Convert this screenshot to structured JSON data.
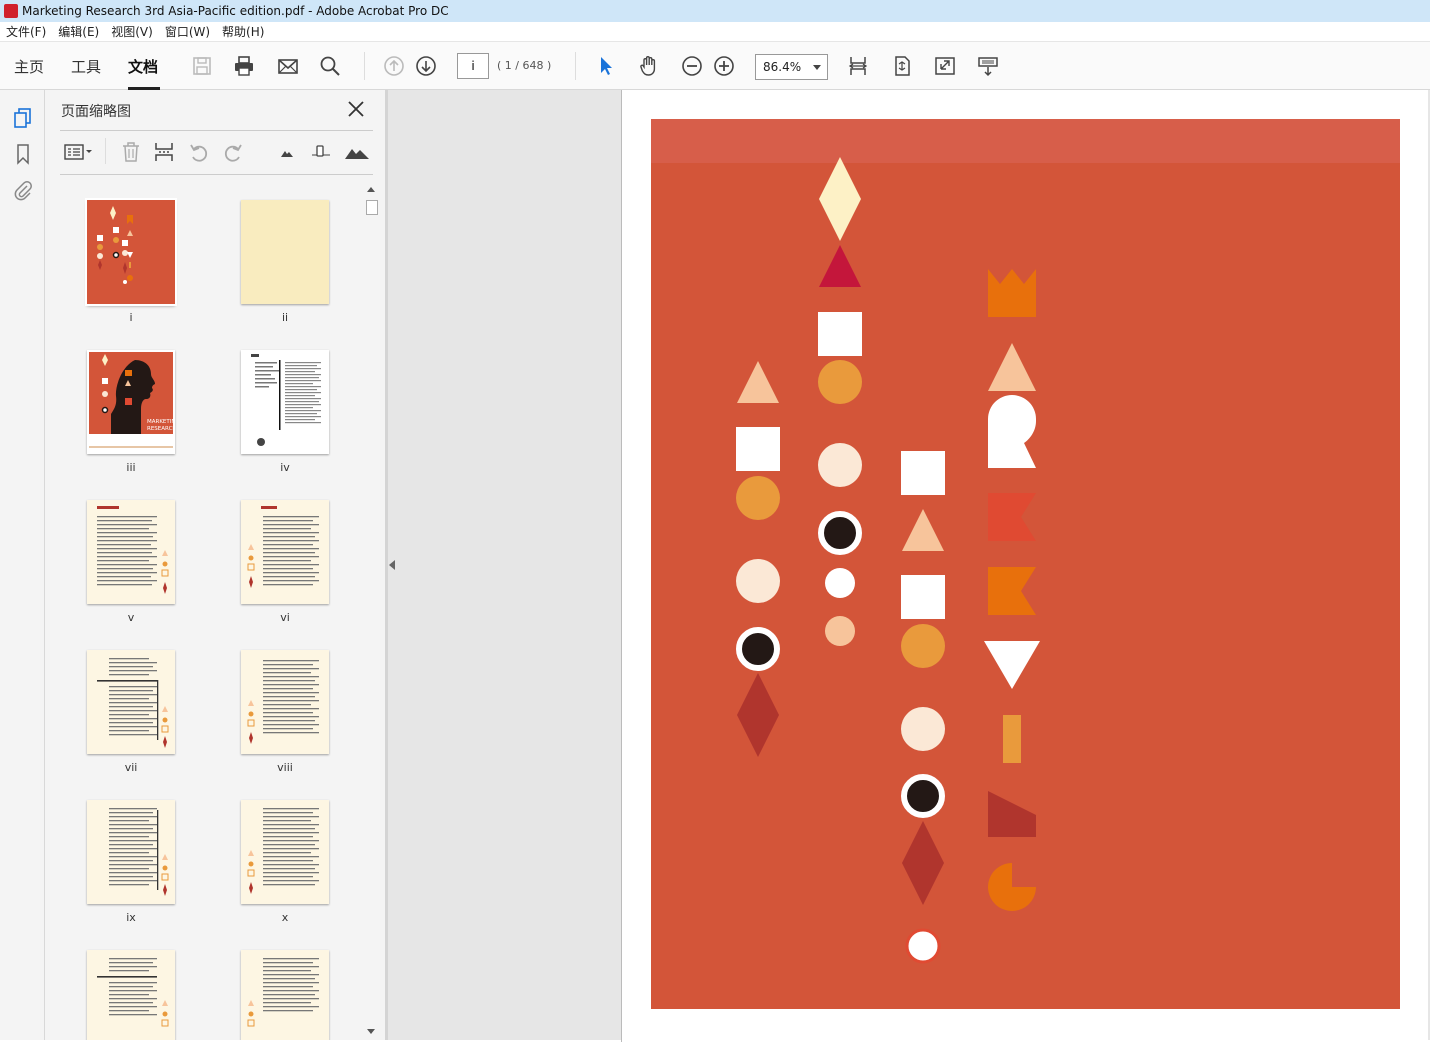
{
  "window": {
    "title": "Marketing Research 3rd Asia-Pacific edition.pdf - Adobe Acrobat Pro DC"
  },
  "menu": [
    "文件(F)",
    "编辑(E)",
    "视图(V)",
    "窗口(W)",
    "帮助(H)"
  ],
  "toolbar": {
    "tabs": [
      "主页",
      "工具",
      "文档"
    ],
    "active_tab": "文档",
    "page_input": "i",
    "page_count": "( 1 / 648 )",
    "zoom": "86.4%"
  },
  "panel": {
    "title": "页面缩略图",
    "thumbnails": [
      "i",
      "ii",
      "iii",
      "iv",
      "v",
      "vi",
      "vii",
      "viii",
      "ix",
      "x"
    ]
  },
  "colors": {
    "cover_bg": "#d35539",
    "cover_top_band": "#d75e4a",
    "cream": "#fdf1c6",
    "crimson": "#c4163b",
    "peach": "#f7c49b",
    "orange": "#e99a3c",
    "light_cream": "#fbe8d6",
    "dark": "#231815",
    "dark_red": "#b0352d",
    "bright_orange": "#e8700c",
    "red_orange": "#e04a32",
    "accent_blue": "#1a73d9"
  }
}
